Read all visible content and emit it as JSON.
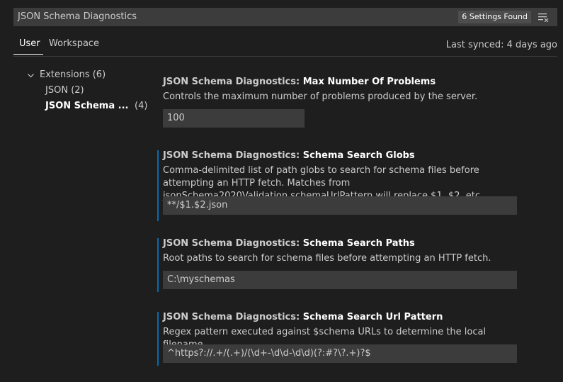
{
  "search": {
    "value": "JSON Schema Diagnostics",
    "found_label": "6 Settings Found"
  },
  "tabs": [
    {
      "label": "User"
    },
    {
      "label": "Workspace"
    }
  ],
  "last_synced": "Last synced: 4 days ago",
  "toc": {
    "extensions": {
      "label": "Extensions",
      "count": "(6)"
    },
    "json": {
      "label": "JSON",
      "count": "(2)"
    },
    "json_schema": {
      "label": "JSON Schema ...",
      "count": "(4)"
    }
  },
  "settings": [
    {
      "category": "JSON Schema Diagnostics: ",
      "name": "Max Number Of Problems",
      "desc": "Controls the maximum number of problems produced by the server.",
      "value": "100"
    },
    {
      "category": "JSON Schema Diagnostics: ",
      "name": "Schema Search Globs",
      "desc": "Comma-delimited list of path globs to search for schema files before attempting an HTTP fetch. Matches from jsonSchema2020Validation.schemaUrlPattern will replace $1, $2, etc.",
      "value": "**/$1.$2.json"
    },
    {
      "category": "JSON Schema Diagnostics: ",
      "name": "Schema Search Paths",
      "desc": "Root paths to search for schema files before attempting an HTTP fetch.",
      "value": "C:\\myschemas"
    },
    {
      "category": "JSON Schema Diagnostics: ",
      "name": "Schema Search Url Pattern",
      "desc": "Regex pattern executed against $schema URLs to determine the local filename.",
      "value": "^https?://.+/(.+)/(\\d+-\\d\\d-\\d\\d)(?:#?\\?.+)?$"
    }
  ]
}
